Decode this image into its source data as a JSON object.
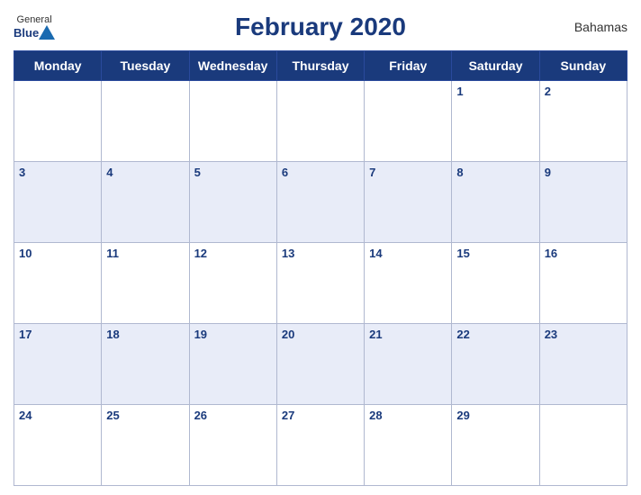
{
  "header": {
    "logo": {
      "general": "General",
      "blue": "Blue",
      "icon": "▲"
    },
    "title": "February 2020",
    "country": "Bahamas"
  },
  "calendar": {
    "days_of_week": [
      "Monday",
      "Tuesday",
      "Wednesday",
      "Thursday",
      "Friday",
      "Saturday",
      "Sunday"
    ],
    "weeks": [
      [
        null,
        null,
        null,
        null,
        null,
        1,
        2
      ],
      [
        3,
        4,
        5,
        6,
        7,
        8,
        9
      ],
      [
        10,
        11,
        12,
        13,
        14,
        15,
        16
      ],
      [
        17,
        18,
        19,
        20,
        21,
        22,
        23
      ],
      [
        24,
        25,
        26,
        27,
        28,
        29,
        null
      ]
    ]
  }
}
